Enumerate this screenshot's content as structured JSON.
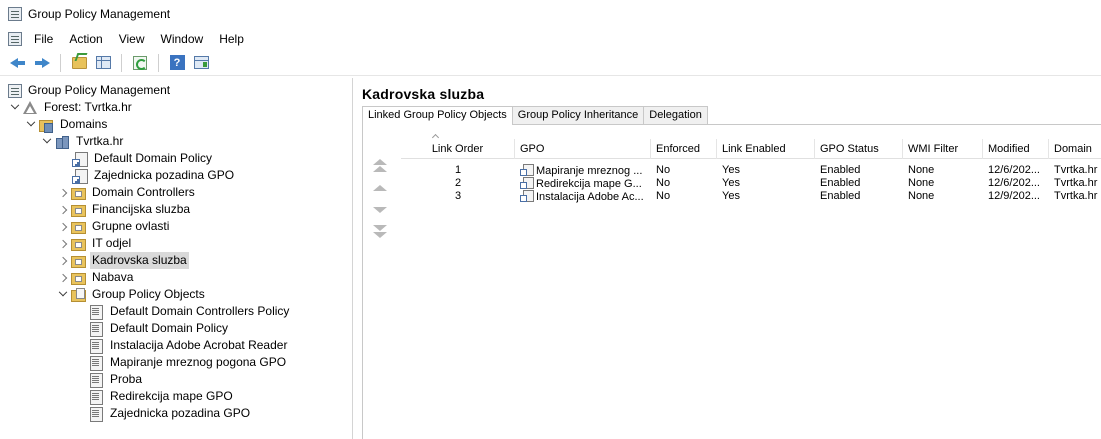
{
  "window": {
    "title": "Group Policy Management"
  },
  "menu": [
    "File",
    "Action",
    "View",
    "Window",
    "Help"
  ],
  "toolbar": {
    "icons": [
      "back-arrow-icon",
      "forward-arrow-icon",
      "up-folder-icon",
      "show-hide-tree-icon",
      "refresh-icon",
      "help-icon",
      "action-pane-icon"
    ]
  },
  "tree": {
    "root": "Group Policy Management",
    "forest": "Forest: Tvrtka.hr",
    "domains": "Domains",
    "domain": "Tvrtka.hr",
    "linked_gpos": [
      "Default Domain Policy",
      "Zajednicka pozadina GPO"
    ],
    "ous": [
      "Domain Controllers",
      "Financijska sluzba",
      "Grupne ovlasti",
      "IT odjel",
      "Kadrovska sluzba",
      "Nabava"
    ],
    "gpo_folder": "Group Policy Objects",
    "gpos": [
      "Default Domain Controllers Policy",
      "Default Domain Policy",
      "Instalacija Adobe Acrobat Reader",
      "Mapiranje mreznog pogona GPO",
      "Proba",
      "Redirekcija mape GPO",
      "Zajednicka pozadina GPO"
    ],
    "selected": "Kadrovska sluzba"
  },
  "details": {
    "title": "Kadrovska sluzba",
    "tabs": [
      "Linked Group Policy Objects",
      "Group Policy Inheritance",
      "Delegation"
    ],
    "active_tab": "Linked Group Policy Objects",
    "columns": [
      "Link Order",
      "GPO",
      "Enforced",
      "Link Enabled",
      "GPO Status",
      "WMI Filter",
      "Modified",
      "Domain"
    ],
    "rows": [
      [
        "1",
        "Mapiranje mreznog ...",
        "No",
        "Yes",
        "Enabled",
        "None",
        "12/6/202...",
        "Tvrtka.hr"
      ],
      [
        "2",
        "Redirekcija mape G...",
        "No",
        "Yes",
        "Enabled",
        "None",
        "12/6/202...",
        "Tvrtka.hr"
      ],
      [
        "3",
        "Instalacija Adobe Ac...",
        "No",
        "Yes",
        "Enabled",
        "None",
        "12/9/202...",
        "Tvrtka.hr"
      ]
    ]
  }
}
